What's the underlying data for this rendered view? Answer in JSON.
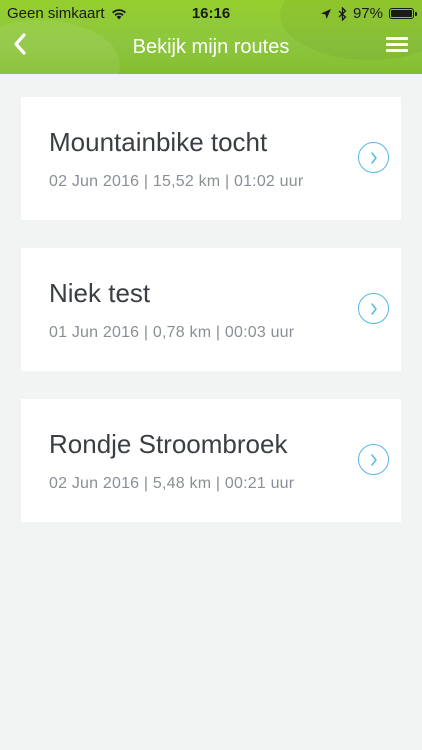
{
  "status_bar": {
    "carrier": "Geen simkaart",
    "time": "16:16",
    "battery": "97%"
  },
  "nav": {
    "title": "Bekijk mijn routes",
    "back_icon": "chevron-left-icon",
    "menu_icon": "hamburger-menu-icon"
  },
  "routes": [
    {
      "name": "Mountainbike tocht",
      "meta": "02 Jun 2016 | 15,52 km | 01:02 uur"
    },
    {
      "name": "Niek test",
      "meta": "01 Jun 2016 | 0,78 km | 00:03 uur"
    },
    {
      "name": "Rondje Stroombroek",
      "meta": "02 Jun 2016 | 5,48 km | 00:21 uur"
    }
  ],
  "colors": {
    "header_green": "#8cc63f",
    "accent_blue": "#56b9e0",
    "background": "#f2f3f3"
  }
}
